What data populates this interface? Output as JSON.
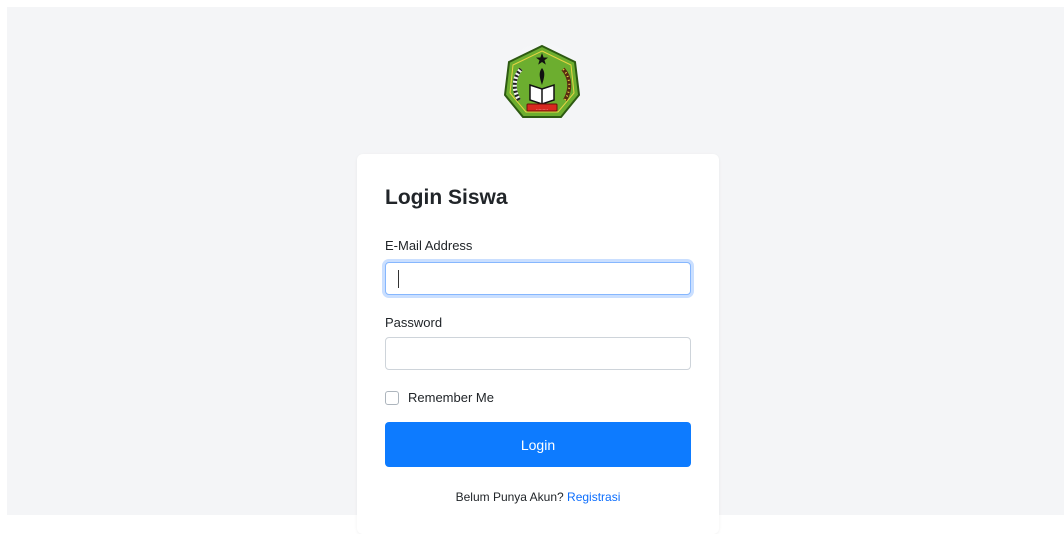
{
  "login": {
    "title": "Login Siswa",
    "email_label": "E-Mail Address",
    "email_value": "",
    "password_label": "Password",
    "password_value": "",
    "remember_label": "Remember Me",
    "remember_checked": false,
    "submit_label": "Login",
    "footer_text": "Belum Punya Akun?",
    "register_link": "Registrasi"
  },
  "colors": {
    "background": "#f4f5f7",
    "card": "#ffffff",
    "primary": "#0d7bff",
    "link": "#0d6efd",
    "logo_green": "#6cae2f"
  },
  "icons": {
    "logo": "school-emblem-icon"
  }
}
